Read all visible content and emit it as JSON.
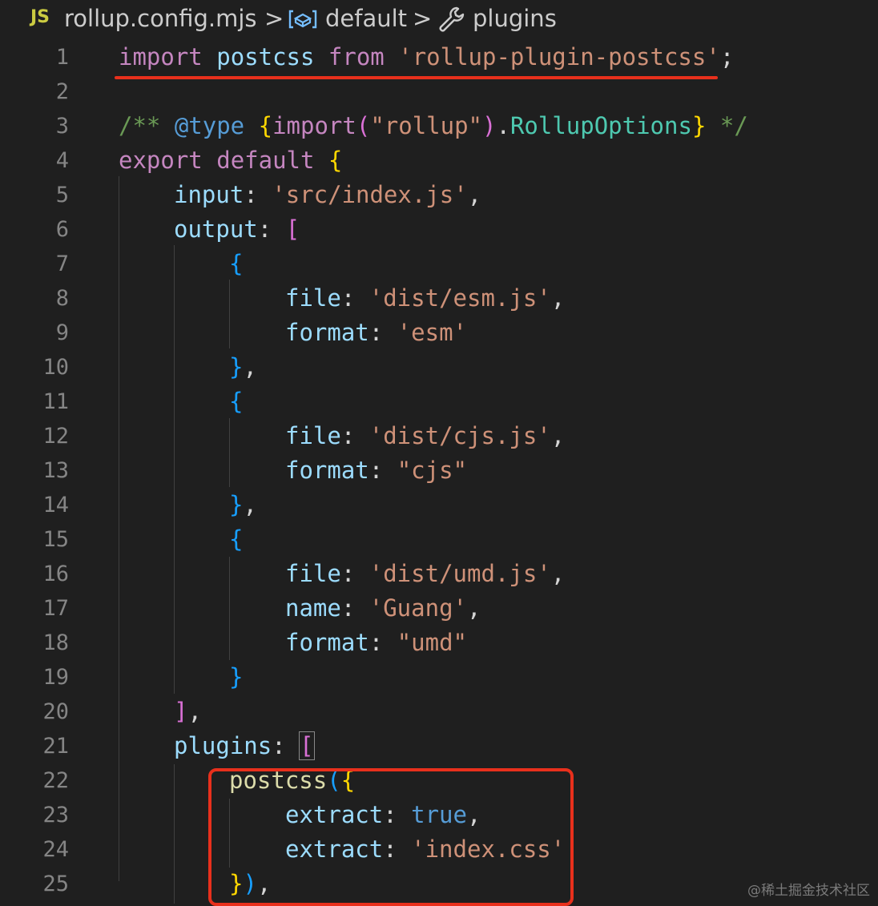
{
  "breadcrumb": {
    "file_icon_label": "JS",
    "file_name": "rollup.config.mjs",
    "separator": ">",
    "symbol_default": "default",
    "symbol_plugins": "plugins",
    "icons": [
      "variable-icon",
      "wrench-icon",
      "chevron-right-icon"
    ]
  },
  "editor": {
    "language": "javascript",
    "visible_lines": [
      1,
      25
    ]
  },
  "code": {
    "l1": {
      "ln": "1",
      "t0": "import",
      "t1": " ",
      "t2": "postcss",
      "t3": " ",
      "t4": "from",
      "t5": " ",
      "t6": "'rollup-plugin-postcss'",
      "t7": ";"
    },
    "l2": {
      "ln": "2"
    },
    "l3": {
      "ln": "3",
      "t0": "/** ",
      "t1": "@type",
      "t2": " ",
      "t3": "{",
      "t4": "import",
      "t5": "(",
      "t6": "\"rollup\"",
      "t7": ")",
      "t8": ".",
      "t9": "RollupOptions",
      "t10": "}",
      "t11": " */"
    },
    "l4": {
      "ln": "4",
      "t0": "export",
      "t1": " ",
      "t2": "default",
      "t3": " ",
      "t4": "{"
    },
    "l5": {
      "ln": "5",
      "t0": "input",
      "t1": ": ",
      "t2": "'src/index.js'",
      "t3": ","
    },
    "l6": {
      "ln": "6",
      "t0": "output",
      "t1": ": ",
      "t2": "["
    },
    "l7": {
      "ln": "7",
      "t0": "{"
    },
    "l8": {
      "ln": "8",
      "t0": "file",
      "t1": ": ",
      "t2": "'dist/esm.js'",
      "t3": ","
    },
    "l9": {
      "ln": "9",
      "t0": "format",
      "t1": ": ",
      "t2": "'esm'"
    },
    "l10": {
      "ln": "10",
      "t0": "}",
      "t1": ","
    },
    "l11": {
      "ln": "11",
      "t0": "{"
    },
    "l12": {
      "ln": "12",
      "t0": "file",
      "t1": ": ",
      "t2": "'dist/cjs.js'",
      "t3": ","
    },
    "l13": {
      "ln": "13",
      "t0": "format",
      "t1": ": ",
      "t2": "\"cjs\""
    },
    "l14": {
      "ln": "14",
      "t0": "}",
      "t1": ","
    },
    "l15": {
      "ln": "15",
      "t0": "{"
    },
    "l16": {
      "ln": "16",
      "t0": "file",
      "t1": ": ",
      "t2": "'dist/umd.js'",
      "t3": ","
    },
    "l17": {
      "ln": "17",
      "t0": "name",
      "t1": ": ",
      "t2": "'Guang'",
      "t3": ","
    },
    "l18": {
      "ln": "18",
      "t0": "format",
      "t1": ": ",
      "t2": "\"umd\""
    },
    "l19": {
      "ln": "19",
      "t0": "}"
    },
    "l20": {
      "ln": "20",
      "t0": "]",
      "t1": ","
    },
    "l21": {
      "ln": "21",
      "t0": "plugins",
      "t1": ": ",
      "t2": "["
    },
    "l22": {
      "ln": "22",
      "t0": "postcss",
      "t1": "(",
      "t2": "{"
    },
    "l23": {
      "ln": "23",
      "t0": "extract",
      "t1": ": ",
      "t2": "true",
      "t3": ","
    },
    "l24": {
      "ln": "24",
      "t0": "extract",
      "t1": ": ",
      "t2": "'index.css'"
    },
    "l25": {
      "ln": "25",
      "t0": "}",
      "t1": ")",
      "t2": ","
    }
  },
  "annotations": {
    "underline_color": "#e8301c",
    "box_color": "#e8301c"
  },
  "watermark": "@稀土掘金技术社区"
}
